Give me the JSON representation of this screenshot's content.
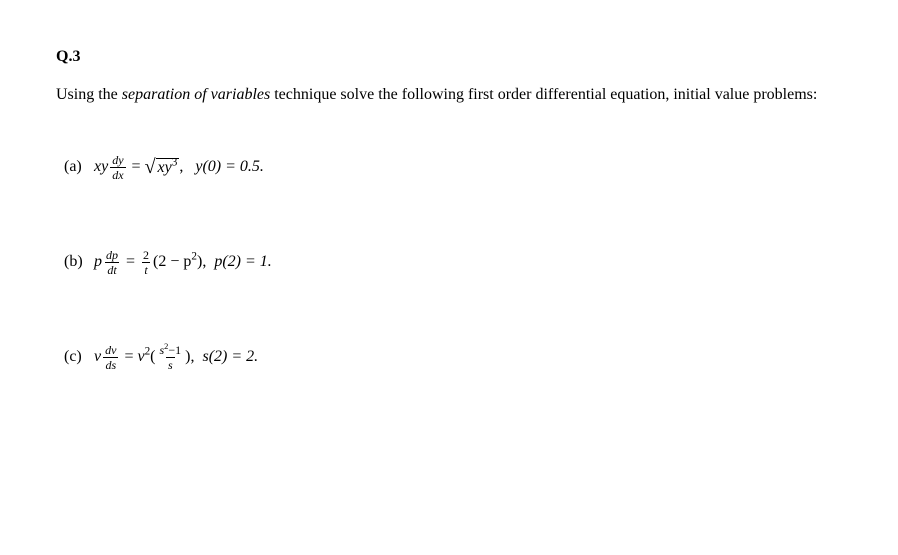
{
  "heading": "Q.3",
  "prompt_pre": "Using the ",
  "prompt_em": "separation of variables",
  "prompt_post": " technique solve the following first order differential equation, initial value problems:",
  "items": {
    "a": {
      "label": "(a)",
      "lhs_var": "xy",
      "frac_num": "dy",
      "frac_den": "dx",
      "radicand_base": "xy",
      "radicand_exp": "3",
      "ic": "y(0) = 0.5."
    },
    "b": {
      "label": "(b)",
      "lhs_var": "p",
      "frac_num": "dp",
      "frac_den": "dt",
      "coeff_num": "2",
      "coeff_den": "t",
      "factor_pre": "(2 − p",
      "factor_exp": "2",
      "factor_post": "),",
      "ic": "p(2) = 1."
    },
    "c": {
      "label": "(c)",
      "lhs_var": "v",
      "frac_num": "dv",
      "frac_den": "ds",
      "v_base": "v",
      "v_exp": "2",
      "inner_num_pre": "s",
      "inner_num_exp": "2",
      "inner_num_post": "−1",
      "inner_den": "s",
      "ic": "s(2) = 2."
    }
  }
}
